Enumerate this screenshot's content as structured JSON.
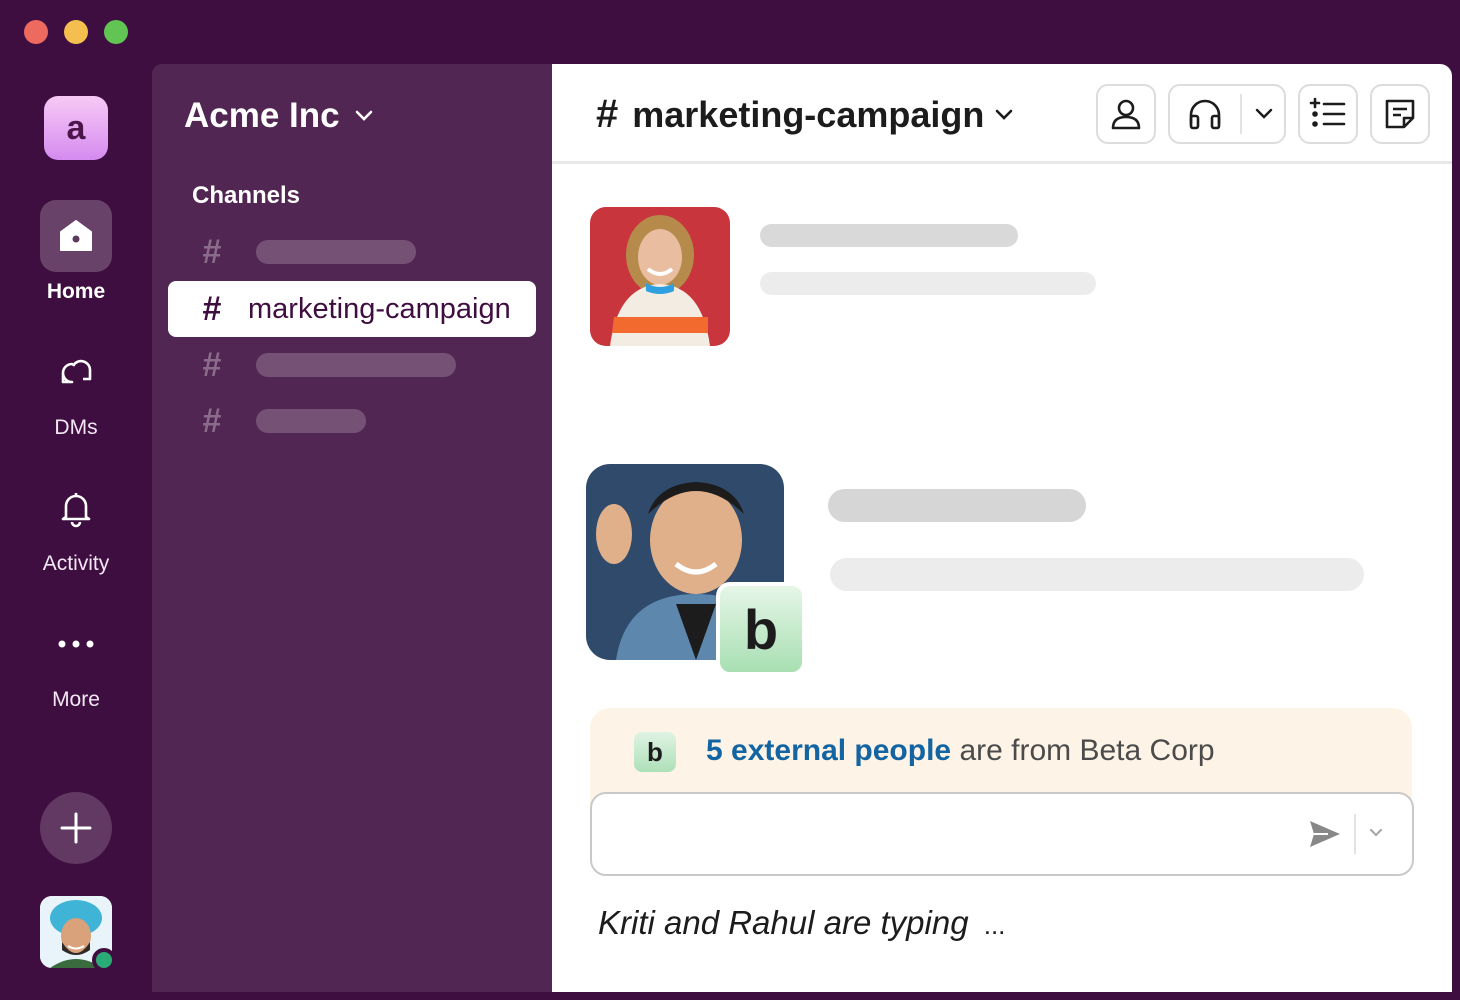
{
  "workspace": {
    "logo_letter": "a",
    "name": "Acme Inc"
  },
  "rail": {
    "home_label": "Home",
    "dms_label": "DMs",
    "activity_label": "Activity",
    "more_label": "More"
  },
  "sidebar": {
    "section_title": "Channels",
    "hash": "#",
    "active_channel": "marketing-campaign"
  },
  "channel": {
    "hash": "#",
    "title": "marketing-campaign"
  },
  "external": {
    "badge_letter": "b",
    "link_text": "5 external people",
    "rest_text": " are from Beta Corp"
  },
  "composer": {
    "placeholder": ""
  },
  "typing": {
    "text": "Kriti and Rahul are typing",
    "dots": "..."
  },
  "colors": {
    "aubergine": "#3f0e40",
    "sidebar": "#522653",
    "link": "#1264a3",
    "presence": "#2bac76",
    "banner": "#fdf3e6"
  }
}
